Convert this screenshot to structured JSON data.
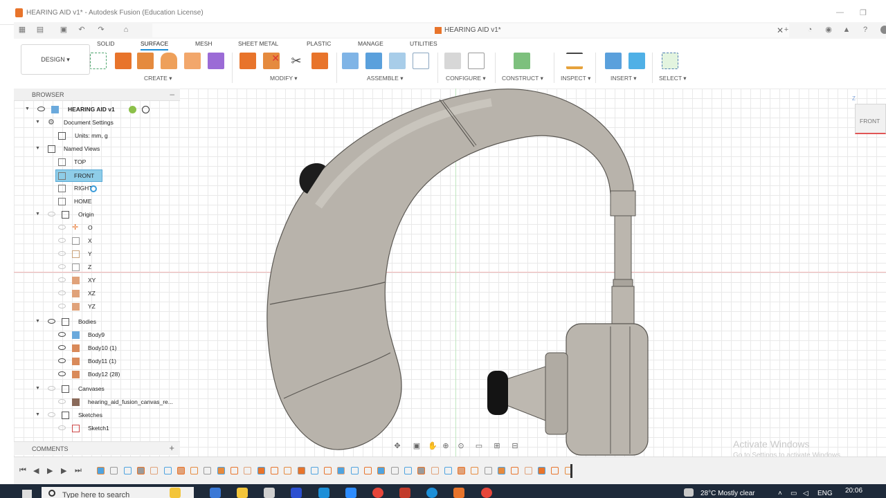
{
  "window": {
    "title": "HEARING AID v1* - Autodesk Fusion (Education License)",
    "minimize": "—",
    "maximize": "❐"
  },
  "document_tab": {
    "title": "HEARING AID v1*",
    "close": "✕"
  },
  "toolbar": {
    "workspace": "DESIGN",
    "tabs": [
      "SOLID",
      "SURFACE",
      "MESH",
      "SHEET METAL",
      "PLASTIC",
      "MANAGE",
      "UTILITIES"
    ],
    "active_tab": "SURFACE",
    "groups": [
      "CREATE",
      "MODIFY",
      "ASSEMBLE",
      "CONFIGURE",
      "CONSTRUCT",
      "INSPECT",
      "INSERT",
      "SELECT"
    ],
    "caret": "▾"
  },
  "browser": {
    "title": "BROWSER",
    "rows": [
      {
        "label": "HEARING AID v1"
      },
      {
        "label": "Document Settings"
      },
      {
        "label": "Units: mm, g"
      },
      {
        "label": "Named Views"
      },
      {
        "label": "TOP"
      },
      {
        "label": "FRONT"
      },
      {
        "label": "RIGHT"
      },
      {
        "label": "HOME"
      },
      {
        "label": "Origin"
      },
      {
        "label": "O"
      },
      {
        "label": "X"
      },
      {
        "label": "Y"
      },
      {
        "label": "Z"
      },
      {
        "label": "XY"
      },
      {
        "label": "XZ"
      },
      {
        "label": "YZ"
      },
      {
        "label": "Bodies"
      },
      {
        "label": "Body9"
      },
      {
        "label": "Body10 (1)"
      },
      {
        "label": "Body11 (1)"
      },
      {
        "label": "Body12 (28)"
      },
      {
        "label": "Canvases"
      },
      {
        "label": "hearing_aid_fusion_canvas_re..."
      },
      {
        "label": "Sketches"
      },
      {
        "label": "Sketch1"
      }
    ]
  },
  "comments": {
    "title": "COMMENTS",
    "add": "+"
  },
  "viewcube": {
    "face": "FRONT",
    "axis": "Z"
  },
  "watermark": {
    "line1": "Activate Windows",
    "line2": "Go to Settings to activate Windows."
  },
  "taskbar": {
    "search_placeholder": "Type here to search",
    "weather": "28°C  Mostly clear",
    "language": "ENG",
    "time": "20:06"
  },
  "colors": {
    "accent": "#1c8fd8",
    "fusion_orange": "#e8742b",
    "model_body": "#b8b3ab",
    "selection": "#8ecde8"
  }
}
